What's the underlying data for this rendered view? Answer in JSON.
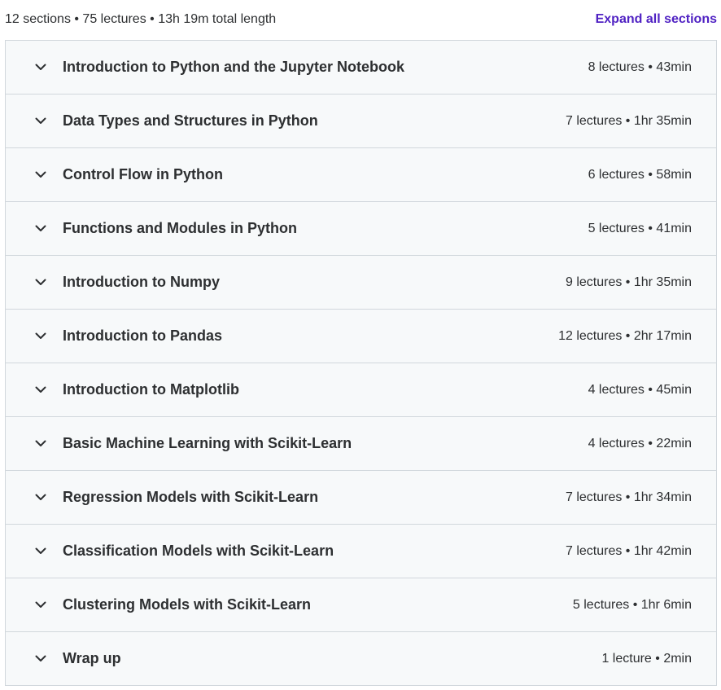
{
  "summary": {
    "text": "12 sections • 75 lectures • 13h 19m total length",
    "expand_label": "Expand all sections"
  },
  "colors": {
    "accent": "#5022c3",
    "row_background": "#f7f9fa",
    "border": "#d1d7dc",
    "text": "#2d2f31"
  },
  "toggle_icon": "chevron-down-icon",
  "sections": [
    {
      "title": "Introduction to Python and the Jupyter Notebook",
      "meta": "8 lectures • 43min"
    },
    {
      "title": "Data Types and Structures in Python",
      "meta": "7 lectures • 1hr 35min"
    },
    {
      "title": "Control Flow in Python",
      "meta": "6 lectures • 58min"
    },
    {
      "title": "Functions and Modules in Python",
      "meta": "5 lectures • 41min"
    },
    {
      "title": "Introduction to Numpy",
      "meta": "9 lectures • 1hr 35min"
    },
    {
      "title": "Introduction to Pandas",
      "meta": "12 lectures • 2hr 17min"
    },
    {
      "title": "Introduction to Matplotlib",
      "meta": "4 lectures • 45min"
    },
    {
      "title": "Basic Machine Learning with Scikit-Learn",
      "meta": "4 lectures • 22min"
    },
    {
      "title": "Regression Models with Scikit-Learn",
      "meta": "7 lectures • 1hr 34min"
    },
    {
      "title": "Classification Models with Scikit-Learn",
      "meta": "7 lectures • 1hr 42min"
    },
    {
      "title": "Clustering Models with Scikit-Learn",
      "meta": "5 lectures • 1hr 6min"
    },
    {
      "title": "Wrap up",
      "meta": "1 lecture • 2min"
    }
  ]
}
